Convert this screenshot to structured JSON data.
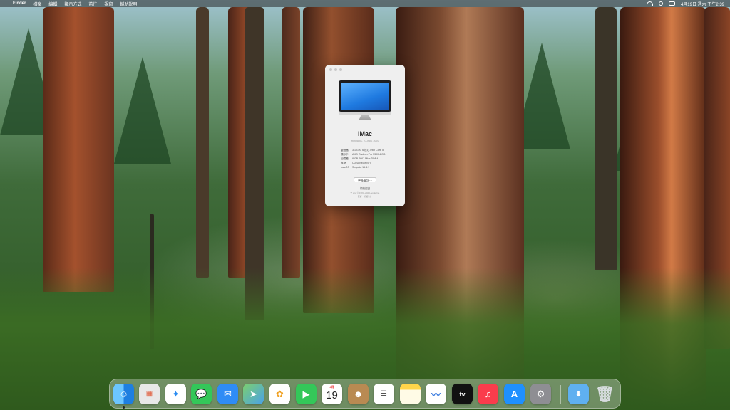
{
  "menubar": {
    "apple": "",
    "app_name": "Finder",
    "menus": [
      "檔案",
      "編輯",
      "顯示方式",
      "前往",
      "視窗",
      "輔助說明"
    ],
    "date_time": "4月19日 週六 下午2:39"
  },
  "about_window": {
    "model_name": "iMac",
    "model_subtitle": "Retina 5K, 27-inch, 2020",
    "specs": [
      {
        "label": "處理器",
        "value": "3.1 GHz 6 核心 Intel Core i5"
      },
      {
        "label": "顯示卡",
        "value": "AMD Radeon Pro 5300 4 GB"
      },
      {
        "label": "記憶體",
        "value": "8 GB 2667 MHz DDR4"
      },
      {
        "label": "序號",
        "value": "C02DT0B5PN7T"
      },
      {
        "label": "macOS",
        "value": "Sequoia 15.4.1"
      }
    ],
    "more_info_button": "更多資訊⋯",
    "legal_link": "規範認證",
    "copyright_line1": "™ and © 1983–2025 Apple Inc.",
    "copyright_line2": "保留一切權利。"
  },
  "dock": {
    "apps": [
      {
        "name": "Finder",
        "icon": "finder-icon",
        "color": "#1e8cf0"
      },
      {
        "name": "Launchpad",
        "icon": "launchpad-icon",
        "color": "#e8e8e8"
      },
      {
        "name": "Safari",
        "icon": "safari-icon",
        "color": "#2a8cf2"
      },
      {
        "name": "Messages",
        "icon": "messages-icon",
        "color": "#33c759"
      },
      {
        "name": "Mail",
        "icon": "mail-icon",
        "color": "#2f8cf5"
      },
      {
        "name": "Maps",
        "icon": "maps-icon",
        "color": "#5ab85c"
      },
      {
        "name": "Photos",
        "icon": "photos-icon",
        "color": "#ffffff"
      },
      {
        "name": "FaceTime",
        "icon": "facetime-icon",
        "color": "#34c759"
      },
      {
        "name": "Calendar",
        "icon": "calendar-icon",
        "color": "#ffffff",
        "month": "4月",
        "day": "19"
      },
      {
        "name": "Contacts",
        "icon": "contacts-icon",
        "color": "#b98a52"
      },
      {
        "name": "Reminders",
        "icon": "reminders-icon",
        "color": "#ffffff"
      },
      {
        "name": "Notes",
        "icon": "notes-icon",
        "color": "#ffd54a"
      },
      {
        "name": "Freeform",
        "icon": "freeform-icon",
        "color": "#ffffff"
      },
      {
        "name": "TV",
        "icon": "tv-icon",
        "color": "#111111",
        "label": "tv"
      },
      {
        "name": "Music",
        "icon": "music-icon",
        "color": "#fa3c4c"
      },
      {
        "name": "App Store",
        "icon": "app-store-icon",
        "color": "#1e90ff"
      },
      {
        "name": "System Settings",
        "icon": "system-settings-icon",
        "color": "#8e8e93"
      },
      {
        "name": "Downloads",
        "icon": "downloads-folder-icon",
        "color": "#5fb0f0"
      },
      {
        "name": "Trash",
        "icon": "trash-icon",
        "color": "#d8dde0"
      }
    ]
  }
}
